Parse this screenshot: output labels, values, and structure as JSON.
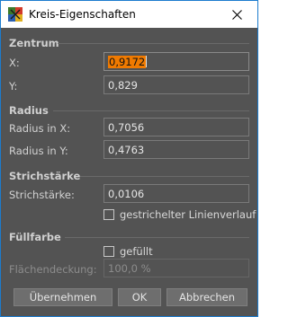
{
  "window": {
    "title": "Kreis-Eigenschaften"
  },
  "sections": {
    "zentrum": {
      "title": "Zentrum",
      "x_label": "X:",
      "x_value": "0,9172",
      "y_label": "Y:",
      "y_value": "0,829"
    },
    "radius": {
      "title": "Radius",
      "x_label": "Radius in X:",
      "x_value": "0,7056",
      "y_label": "Radius in Y:",
      "y_value": "0,4763"
    },
    "strichstaerke": {
      "title": "Strichstärke",
      "label": "Strichstärke:",
      "value": "0,0106",
      "dashed_label": "gestrichelter Linienverlauf",
      "dashed_checked": false
    },
    "fuellfarbe": {
      "title": "Füllfarbe",
      "filled_label": "gefüllt",
      "filled_checked": false,
      "coverage_label": "Flächendeckung:",
      "coverage_value": "100,0 %"
    }
  },
  "buttons": {
    "apply": "Übernehmen",
    "ok": "OK",
    "cancel": "Abbrechen"
  },
  "colors": {
    "background": "#535353",
    "selection": "#f07a00",
    "border_accent": "#1c7cce"
  },
  "icons": {
    "app": "kreis-app-icon",
    "close": "close-icon"
  }
}
